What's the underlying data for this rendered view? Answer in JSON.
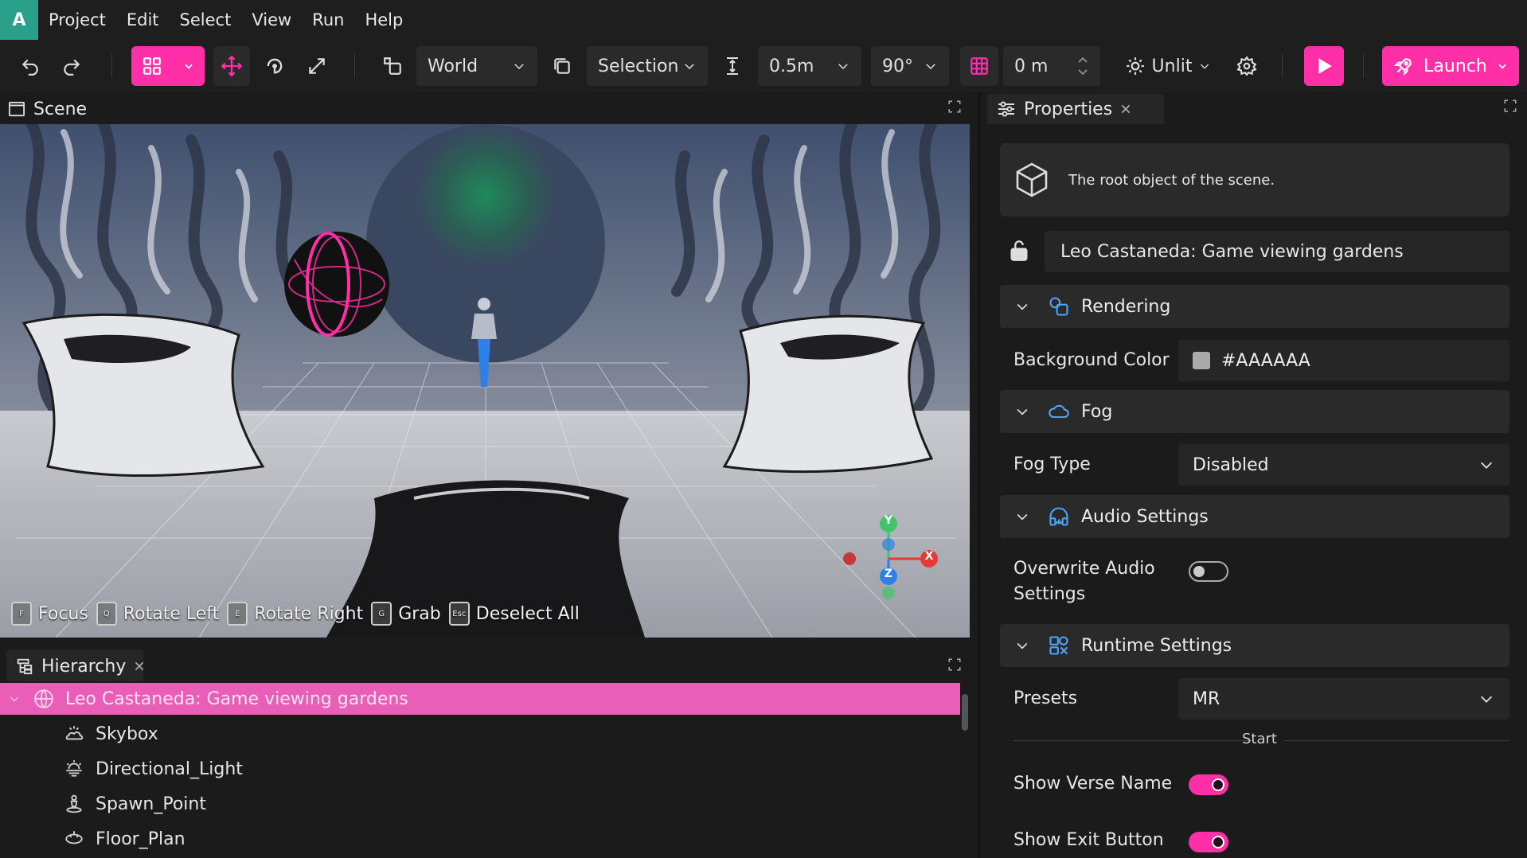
{
  "app": {
    "logo": "A"
  },
  "menu": [
    "Project",
    "Edit",
    "Select",
    "View",
    "Run",
    "Help"
  ],
  "toolbar": {
    "space": "World",
    "selection": "Selection",
    "snap_distance": "0.5m",
    "snap_angle": "90°",
    "grid_height": "0 m",
    "lighting": "Unlit",
    "launch_label": "Launch"
  },
  "scene_panel": {
    "tab_label": "Scene",
    "hints": [
      {
        "key": "F",
        "label": "Focus"
      },
      {
        "key": "Q",
        "label": "Rotate Left"
      },
      {
        "key": "E",
        "label": "Rotate Right"
      },
      {
        "key": "G",
        "label": "Grab"
      },
      {
        "key": "Esc",
        "label": "Deselect All"
      }
    ],
    "gizmo": {
      "y": "Y",
      "x": "X",
      "z": "Z"
    }
  },
  "hierarchy": {
    "tab_label": "Hierarchy",
    "root": "Leo Castaneda: Game viewing gardens",
    "children": [
      "Skybox",
      "Directional_Light",
      "Spawn_Point",
      "Floor_Plan"
    ]
  },
  "properties": {
    "tab_label": "Properties",
    "description": "The root object of the scene.",
    "name": "Leo Castaneda: Game viewing gardens",
    "rendering": {
      "title": "Rendering",
      "background_color_label": "Background Color",
      "background_color_value": "#AAAAAA",
      "swatch": "#AAAAAA"
    },
    "fog": {
      "title": "Fog",
      "type_label": "Fog Type",
      "type_value": "Disabled"
    },
    "audio": {
      "title": "Audio Settings",
      "overwrite_label_1": "Overwrite Audio",
      "overwrite_label_2": "Settings",
      "overwrite": false
    },
    "runtime": {
      "title": "Runtime Settings",
      "presets_label": "Presets",
      "presets_value": "MR",
      "start_divider": "Start",
      "show_verse_name_label": "Show Verse Name",
      "show_verse_name": true,
      "show_exit_button_label": "Show Exit Button",
      "show_exit_button": true
    }
  },
  "colors": {
    "accent": "#FF2FA7",
    "logo_bg": "#2AA08B",
    "selected_row": "#E95FB8",
    "panel_bg": "#1B1B1B"
  },
  "icons": [
    "undo-icon",
    "redo-icon",
    "grid-view-icon",
    "move-icon",
    "rotate-icon",
    "scale-icon",
    "pivot-icon",
    "selection-box-icon",
    "snap-distance-icon",
    "grid-icon",
    "sun-icon",
    "gear-icon",
    "play-icon",
    "rocket-icon",
    "cube-icon",
    "lock-icon",
    "rendering-icon",
    "cloud-icon",
    "headphones-icon",
    "runtime-icon",
    "scene-icon",
    "hierarchy-icon",
    "properties-icon"
  ]
}
